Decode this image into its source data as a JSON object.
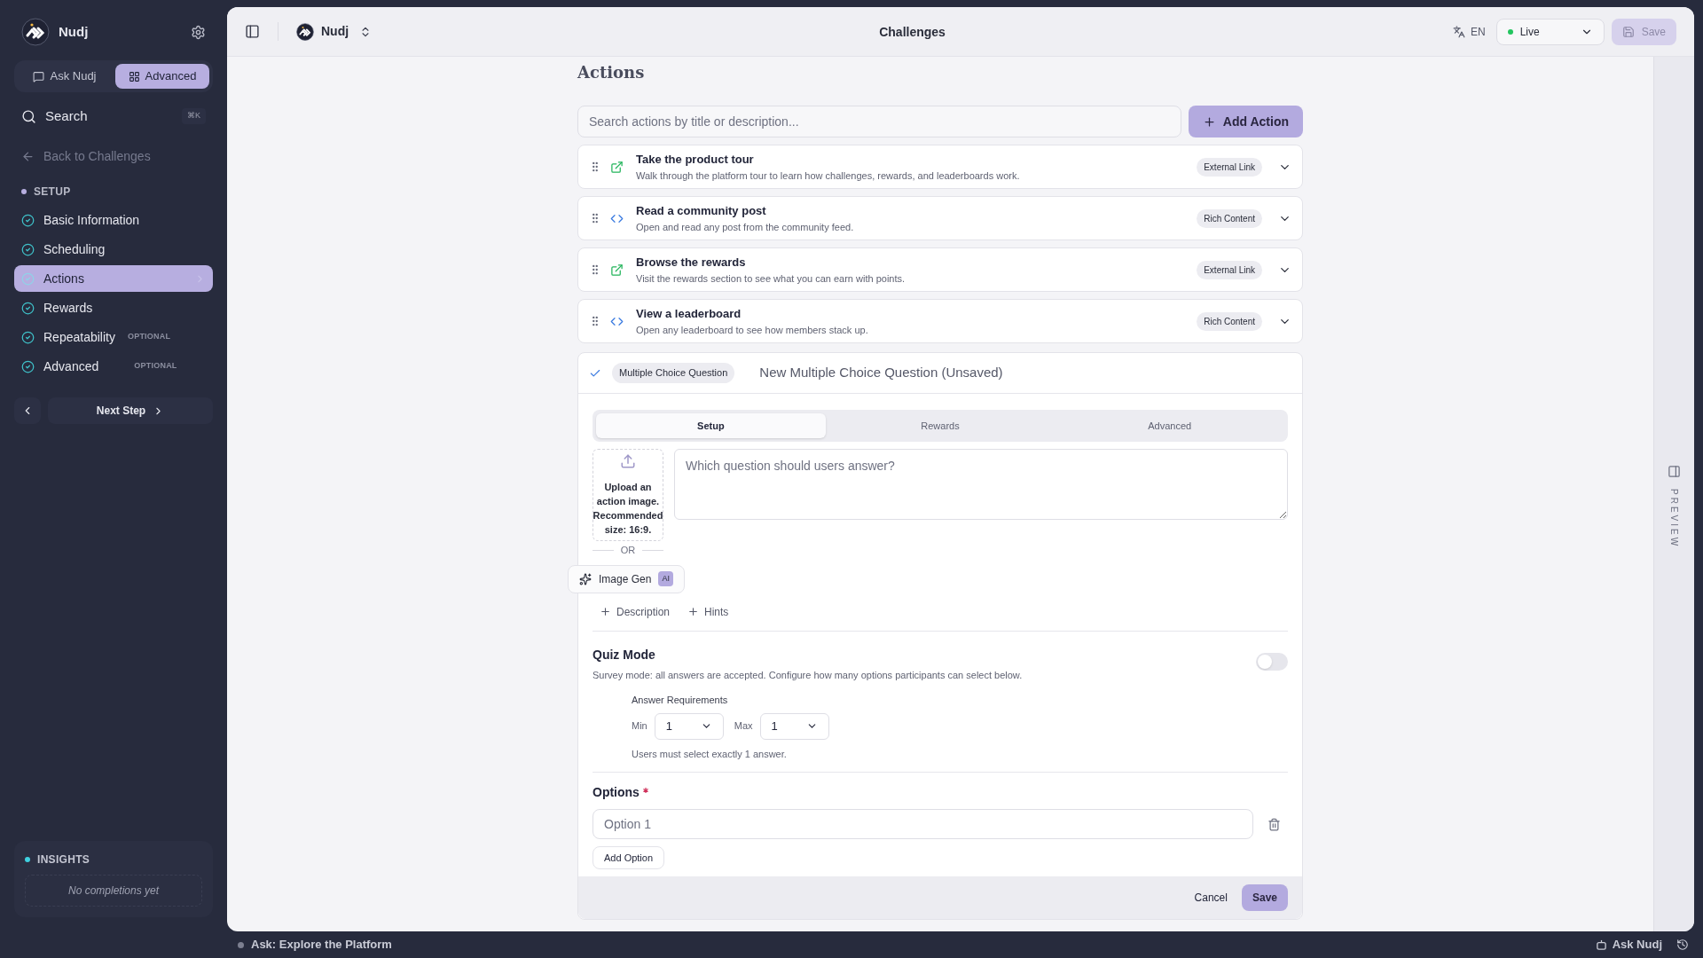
{
  "sidebar": {
    "brand": "Nudj",
    "mode_tabs": [
      {
        "label": "Ask Nudj",
        "selected": false,
        "kind": "chat"
      },
      {
        "label": "Advanced",
        "selected": true,
        "kind": "grid"
      }
    ],
    "search": {
      "label": "Search",
      "shortcut": "⌘K"
    },
    "back_link": "Back to Challenges",
    "section": "SETUP",
    "steps": [
      {
        "label": "Basic Information",
        "completed": true,
        "selected": false
      },
      {
        "label": "Scheduling",
        "completed": true,
        "selected": false
      },
      {
        "label": "Actions",
        "completed": true,
        "selected": true
      },
      {
        "label": "Rewards",
        "completed": true,
        "selected": false
      },
      {
        "label": "Repeatability",
        "completed": true,
        "selected": false,
        "badge": "OPTIONAL"
      },
      {
        "label": "Advanced",
        "completed": true,
        "selected": false,
        "badge": "OPTIONAL"
      }
    ],
    "next_step": "Next Step",
    "insights": {
      "title": "INSIGHTS",
      "empty": "No completions yet"
    }
  },
  "topbar": {
    "workspace": "Nudj",
    "title": "Challenges",
    "language": "EN",
    "status": {
      "label": "Live",
      "color": "#22c55e"
    },
    "save": {
      "label": "Save",
      "disabled": true
    }
  },
  "actions": {
    "heading": "Actions",
    "search_placeholder": "Search actions by title or description...",
    "add_button": "Add Action",
    "items": [
      {
        "title": "Take the product tour",
        "description": "Walk through the platform tour to learn how challenges, rewards, and leaderboards work.",
        "type_label": "External Link",
        "kind": "link"
      },
      {
        "title": "Read a community post",
        "description": "Open and read any post from the community feed.",
        "type_label": "Rich Content",
        "kind": "content"
      },
      {
        "title": "Browse the rewards",
        "description": "Visit the rewards section to see what you can earn with points.",
        "type_label": "External Link",
        "kind": "link"
      },
      {
        "title": "View a leaderboard",
        "description": "Open any leaderboard to see how members stack up.",
        "type_label": "Rich Content",
        "kind": "content"
      }
    ]
  },
  "editor": {
    "type_label": "Multiple Choice Question",
    "title": "New Multiple Choice Question (Unsaved)",
    "tabs": [
      {
        "label": "Setup",
        "selected": true
      },
      {
        "label": "Rewards",
        "selected": false
      },
      {
        "label": "Advanced",
        "selected": false
      }
    ],
    "upload_text": "Upload an action image. Recommended size: 16:9.",
    "or": "OR",
    "image_gen": "Image Gen",
    "ai_badge": "AI",
    "question_placeholder": "Which question should users answer?",
    "add_links": [
      "Description",
      "Hints"
    ],
    "quiz": {
      "title": "Quiz Mode",
      "description": "Survey mode: all answers are accepted. Configure how many options participants can select below.",
      "on": false
    },
    "requirements": {
      "title": "Answer Requirements",
      "min_label": "Min",
      "min_value": "1",
      "max_label": "Max",
      "max_value": "1",
      "summary": "Users must select exactly 1 answer."
    },
    "options": {
      "title": "Options",
      "required": true,
      "items": [
        {
          "placeholder": "Option 1"
        }
      ],
      "add": "Add Option"
    },
    "cancel": "Cancel",
    "save": "Save"
  },
  "preview": "PREVIEW",
  "bottom": {
    "ask": "Ask: Explore the Platform",
    "ask_nudj": "Ask Nudj"
  }
}
